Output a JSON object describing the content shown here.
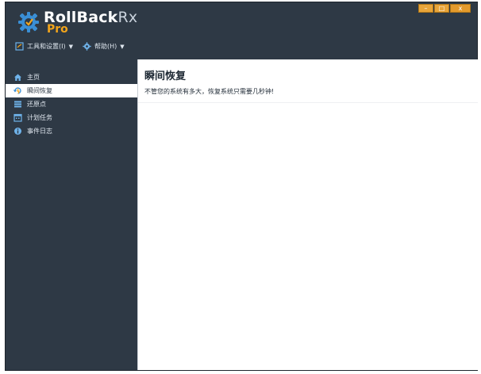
{
  "app": {
    "name_main": "RollBack",
    "name_suffix": "Rx",
    "edition": "Pro"
  },
  "window_controls": {
    "minimize": "–",
    "maximize": "□",
    "close": "x"
  },
  "menubar": {
    "tools_label": "工具和设置(I)",
    "help_label": "帮助(H)"
  },
  "sidebar": {
    "items": [
      {
        "label": "主页",
        "icon": "home-icon"
      },
      {
        "label": "瞬间恢复",
        "icon": "instant-restore-icon"
      },
      {
        "label": "还原点",
        "icon": "restore-point-icon"
      },
      {
        "label": "计划任务",
        "icon": "calendar-icon"
      },
      {
        "label": "事件日志",
        "icon": "info-icon"
      }
    ],
    "active_index": 1
  },
  "content": {
    "title": "瞬间恢复",
    "description": "不管您的系统有多大，恢复系统只需要几秒钟!"
  },
  "colors": {
    "chrome_bg": "#2e3945",
    "accent_orange": "#f3a51b",
    "text_light": "#dfe6ee",
    "active_bg": "#ffffff"
  }
}
